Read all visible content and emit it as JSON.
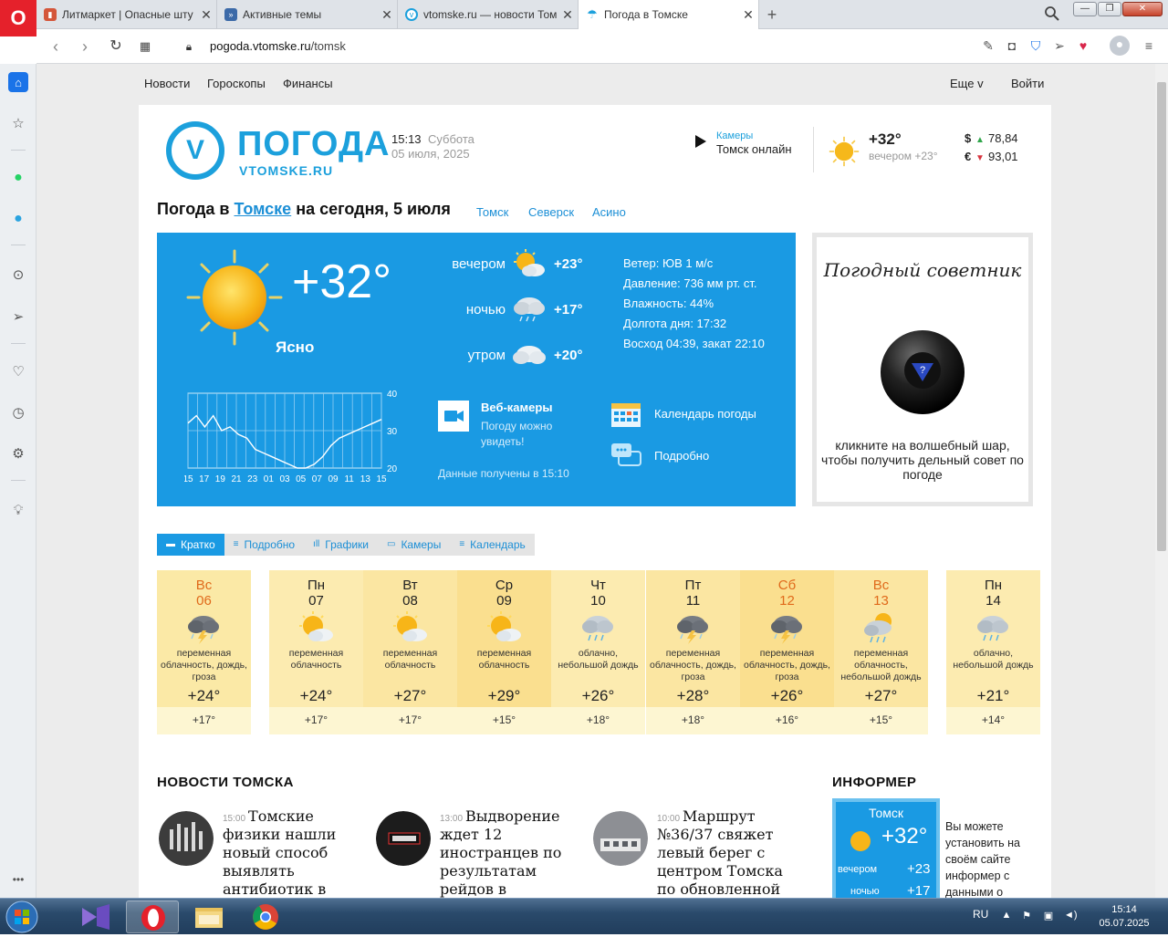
{
  "browser": {
    "tabs": [
      {
        "title": "Литмаркет | Опасные шту",
        "icon": "litmarket-icon",
        "color": "#d4563a"
      },
      {
        "title": "Активные темы",
        "icon": "forum-icon",
        "color": "#3c6aa8"
      },
      {
        "title": "vtomske.ru — новости Том",
        "icon": "vtomske-icon",
        "color": "#1ca0dc"
      },
      {
        "title": "Погода в Томске",
        "icon": "weather-icon",
        "color": "#1ca0dc"
      }
    ],
    "url_domain": "pogoda.vtomske.ru",
    "url_path": "/tomsk"
  },
  "topnav": {
    "left": [
      "Новости",
      "Гороскопы",
      "Финансы"
    ],
    "more": "Еще v",
    "login": "Войти"
  },
  "header": {
    "logo_letter": "V",
    "logo_title": "ПОГОДА",
    "logo_sub": "VTOMSKE.RU",
    "time": "15:13",
    "weekday": "Суббота",
    "date": "05 июля, 2025",
    "cam_label": "Камеры",
    "cam_text": "Томск онлайн",
    "temp": "+32°",
    "evening": "вечером +23°",
    "usd_sym": "$",
    "usd": "78,84",
    "eur_sym": "€",
    "eur": "93,01"
  },
  "title": {
    "prefix": "Погода в",
    "city": "Томске",
    "suffix": "на сегодня, 5 июля",
    "cities": [
      "Томск",
      "Северск",
      "Асино"
    ]
  },
  "now": {
    "temp": "+32°",
    "condition": "Ясно",
    "periods": [
      {
        "label": "вечером",
        "temp": "+23°",
        "icon": "sun-cloud-icon"
      },
      {
        "label": "ночью",
        "temp": "+17°",
        "icon": "cloud-rain-icon"
      },
      {
        "label": "утром",
        "temp": "+20°",
        "icon": "cloud-icon"
      }
    ],
    "details": [
      "Ветер: ЮВ 1 м/с",
      "Давление: 736 мм рт. ст.",
      "Влажность: 44%",
      "Долгота дня: 17:32",
      "Восход 04:39, закат 22:10"
    ],
    "graph": {
      "x_labels": [
        "15",
        "17",
        "19",
        "21",
        "23",
        "01",
        "03",
        "05",
        "07",
        "09",
        "11",
        "13",
        "15"
      ],
      "y_labels": [
        "40",
        "30",
        "20"
      ],
      "values": [
        32,
        34,
        31,
        34,
        30,
        31,
        29,
        28,
        25,
        24,
        23,
        22,
        21,
        20,
        20,
        21,
        23,
        26,
        28,
        29,
        30,
        31,
        32,
        33
      ]
    },
    "webcam_title": "Веб-камеры",
    "webcam_sub": "Погоду можно увидеть!",
    "received": "Данные получены в 15:10",
    "calendar": "Календарь погоды",
    "detailed": "Подробно"
  },
  "advisor": {
    "title": "Погодный советник",
    "text": "кликните на волшебный шар, чтобы получить дельный совет по погоде"
  },
  "tabs": [
    "Кратко",
    "Подробно",
    "Графики",
    "Камеры",
    "Календарь"
  ],
  "forecast": [
    {
      "dow": "Вс",
      "date": "06",
      "desc": "переменная облачность, дождь, гроза",
      "max": "+24°",
      "min": "+17°",
      "icon": "storm-icon",
      "weekend": true
    },
    {
      "dow": "Пн",
      "date": "07",
      "desc": "переменная облачность",
      "max": "+24°",
      "min": "+17°",
      "icon": "sun-cloud-icon",
      "weekend": false
    },
    {
      "dow": "Вт",
      "date": "08",
      "desc": "переменная облачность",
      "max": "+27°",
      "min": "+17°",
      "icon": "sun-cloud-icon",
      "weekend": false
    },
    {
      "dow": "Ср",
      "date": "09",
      "desc": "переменная облачность",
      "max": "+29°",
      "min": "+15°",
      "icon": "sun-cloud-icon",
      "weekend": false
    },
    {
      "dow": "Чт",
      "date": "10",
      "desc": "облачно, небольшой дождь",
      "max": "+26°",
      "min": "+18°",
      "icon": "cloud-rain-icon",
      "weekend": false
    },
    {
      "dow": "Пт",
      "date": "11",
      "desc": "переменная облачность, дождь, гроза",
      "max": "+28°",
      "min": "+18°",
      "icon": "storm-icon",
      "weekend": false
    },
    {
      "dow": "Сб",
      "date": "12",
      "desc": "переменная облачность, дождь, гроза",
      "max": "+26°",
      "min": "+16°",
      "icon": "storm-icon",
      "weekend": true
    },
    {
      "dow": "Вс",
      "date": "13",
      "desc": "переменная облачность, небольшой дождь",
      "max": "+27°",
      "min": "+15°",
      "icon": "sun-rain-icon",
      "weekend": true
    },
    {
      "dow": "Пн",
      "date": "14",
      "desc": "облачно, небольшой дождь",
      "max": "+21°",
      "min": "+14°",
      "icon": "cloud-rain-icon",
      "weekend": false
    }
  ],
  "news": {
    "heading": "НОВОСТИ ТОМСКА",
    "items": [
      {
        "time": "15:00",
        "title": "Томские физики нашли новый способ выявлять антибиотик в"
      },
      {
        "time": "13:00",
        "title": "Выдворение ждет 12 иностранцев по результатам рейдов в Томской области"
      },
      {
        "time": "10:00",
        "title": "Маршрут №36/37 свяжет левый берег с центром Томска по обновленной схеме."
      }
    ]
  },
  "informer": {
    "heading": "ИНФОРМЕР",
    "city": "Томск",
    "temp": "+32°",
    "evening": "вечером",
    "evening_temp": "+23",
    "night": "ночью",
    "night_temp": "+17",
    "note": "Вы можете установить на своём сайте информер с данными о"
  },
  "taskbar": {
    "lang": "RU",
    "time": "15:14",
    "date": "05.07.2025"
  }
}
